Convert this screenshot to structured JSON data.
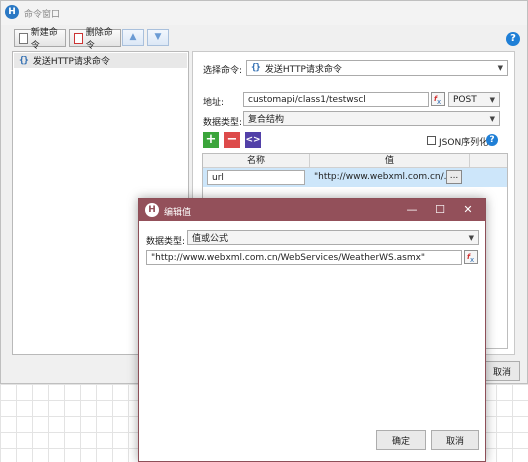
{
  "main_window": {
    "title": "命令窗口",
    "toolbar": {
      "new_label": "新建命令",
      "delete_label": "删除命令",
      "up_glyph": "▲",
      "down_glyph": "▼",
      "help_glyph": "?"
    },
    "tree": {
      "items": [
        {
          "label": "发送HTTP请求命令",
          "icon": "function-brace-icon"
        }
      ]
    },
    "form": {
      "select_command_label": "选择命令:",
      "select_command_value": "发送HTTP请求命令",
      "address_label": "地址:",
      "address_value": "customapi/class1/testwscl",
      "method_value": "POST",
      "data_type_label": "数据类型:",
      "data_type_value": "复合结构",
      "json_serialize_label": "JSON序列化",
      "help_glyph": "?"
    },
    "grid": {
      "columns": [
        "名称",
        "值"
      ],
      "rows": [
        {
          "name": "url",
          "value": "\"http://www.webxml.com.cn/...",
          "button": "..."
        }
      ]
    },
    "cancel_label": "取消"
  },
  "dialog": {
    "title": "编辑值",
    "data_type_label": "数据类型:",
    "data_type_value": "值或公式",
    "value": "\"http://www.webxml.com.cn/WebServices/WeatherWS.asmx\"",
    "ok_label": "确定",
    "cancel_label": "取消",
    "minimize_glyph": "—",
    "maximize_glyph": "☐",
    "close_glyph": "✕"
  },
  "colors": {
    "dialog_titlebar": "#93505a",
    "selected_row": "#cde6fa",
    "add_button": "#3ba53b",
    "remove_button": "#dd4a4a",
    "code_button": "#5240a8",
    "help_blue": "#1f7fd6"
  }
}
